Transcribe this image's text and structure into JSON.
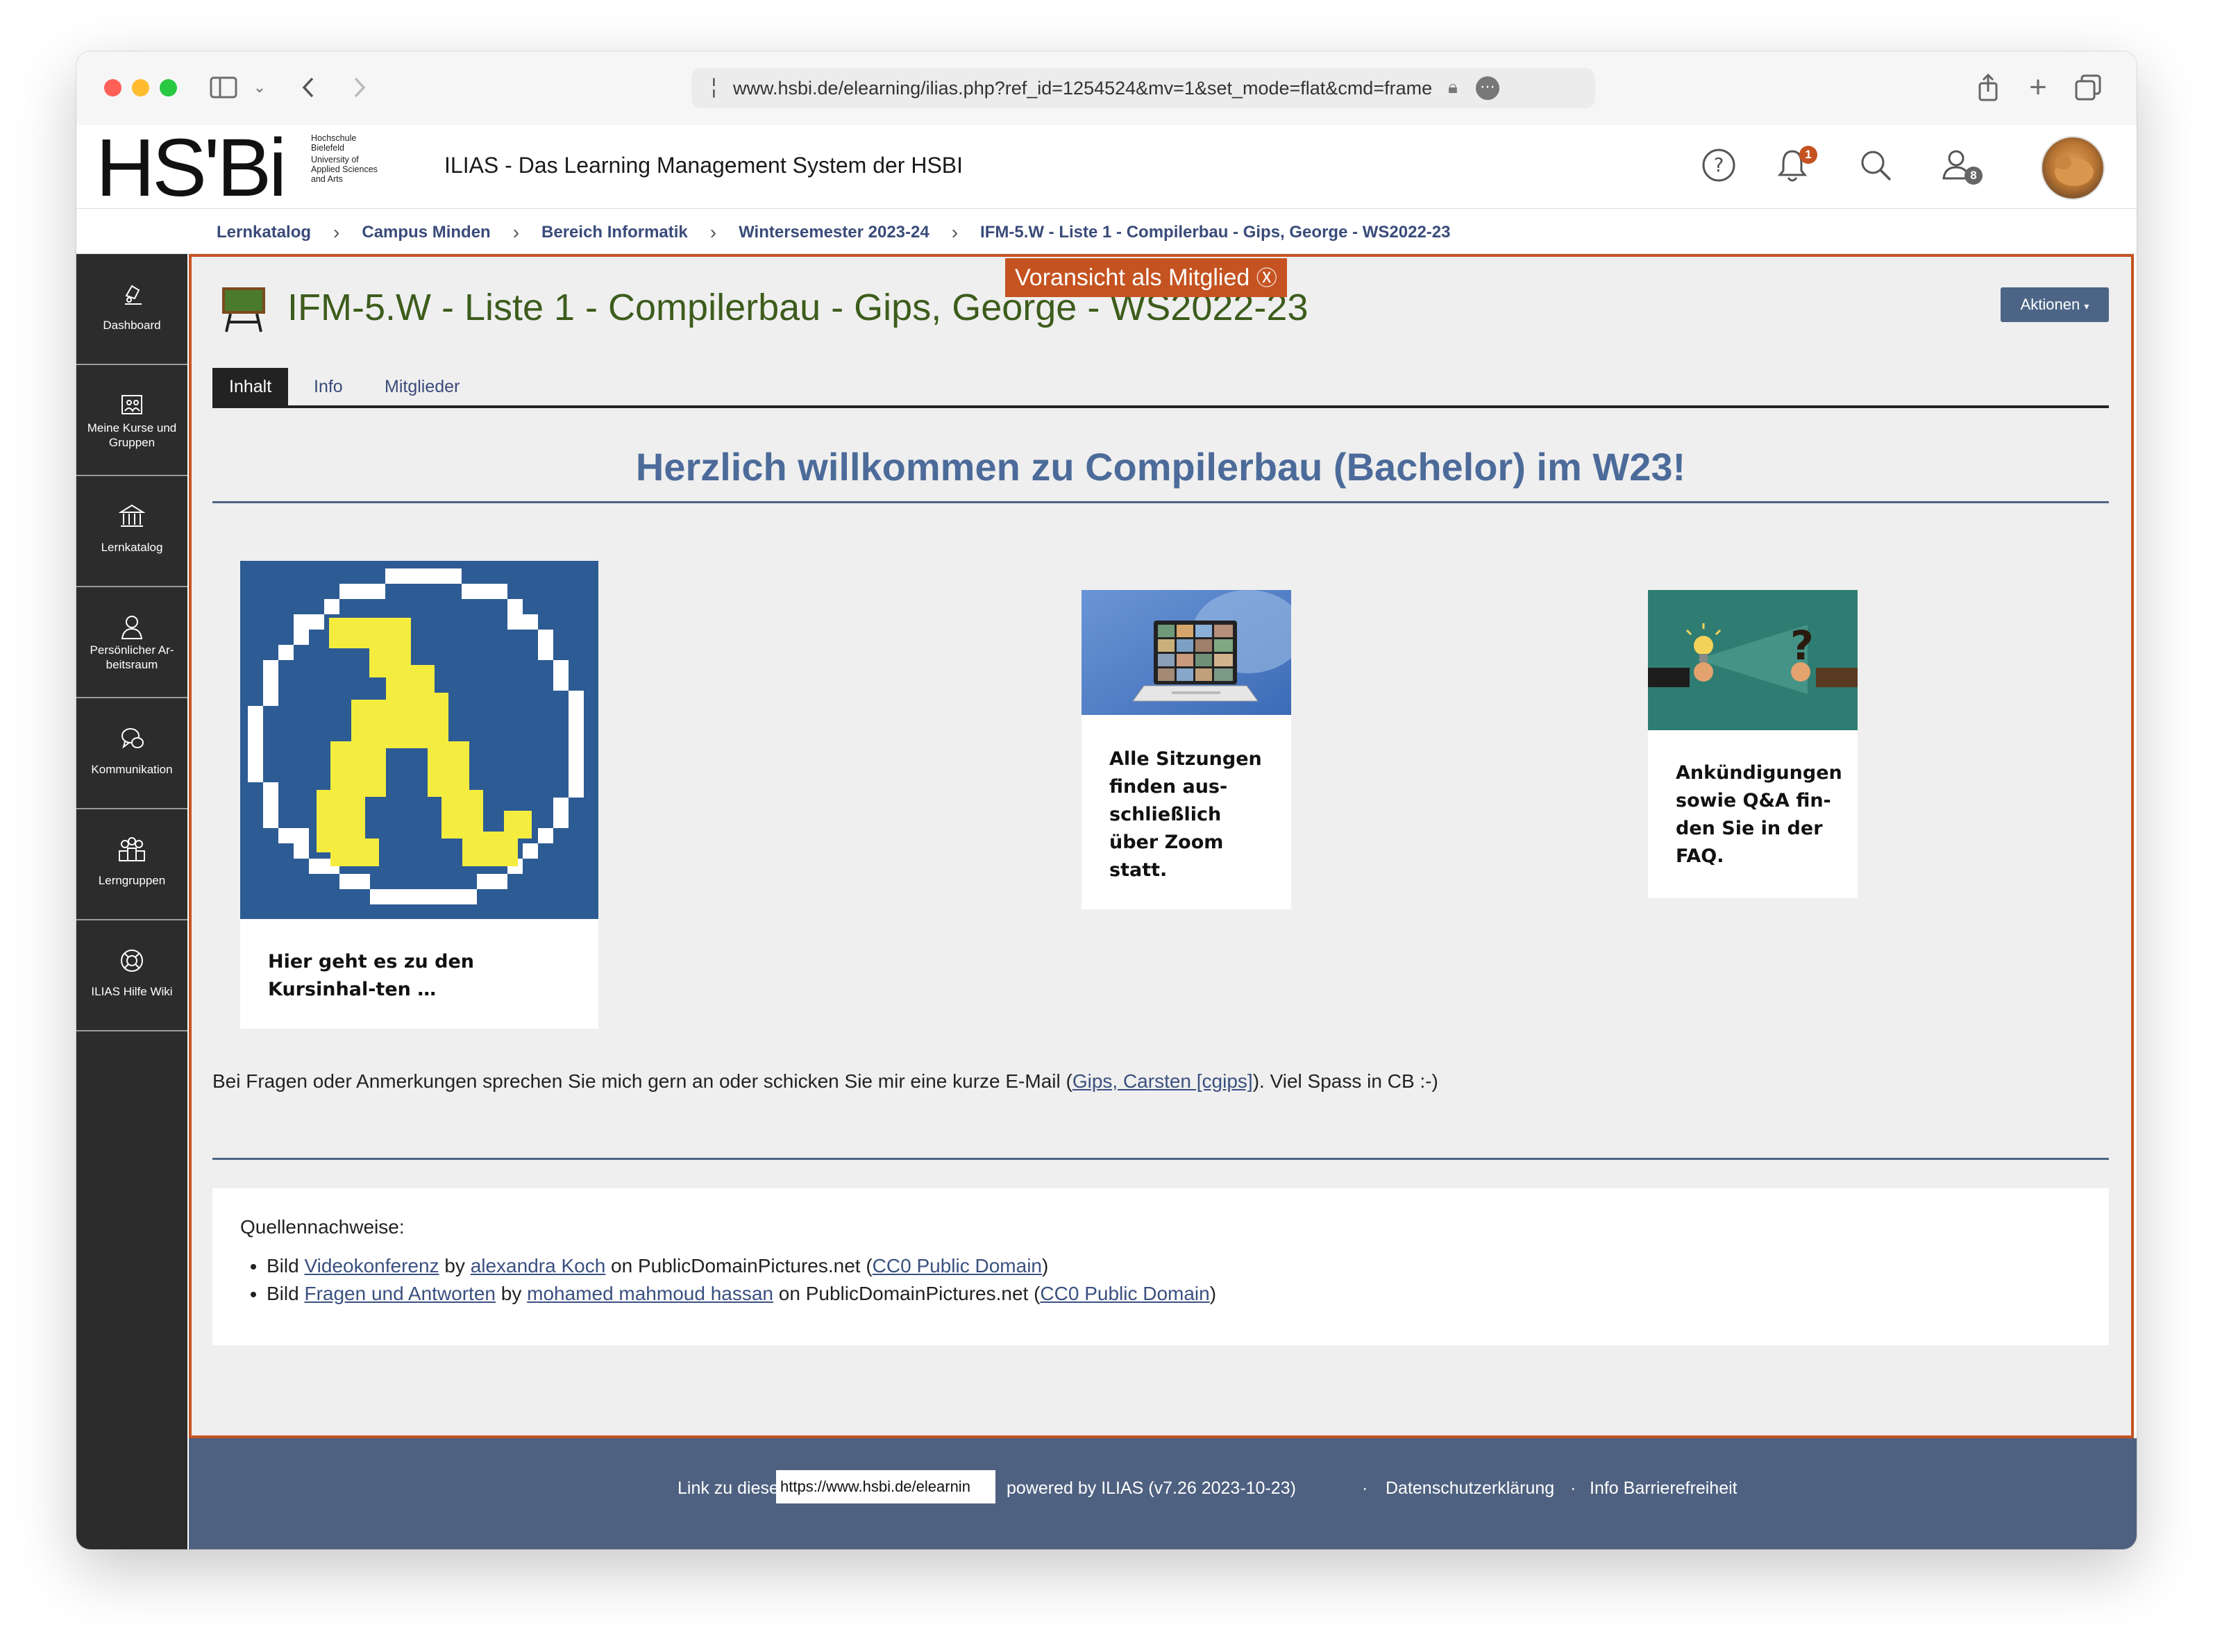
{
  "browser": {
    "url": "www.hsbi.de/elearning/ilias.php?ref_id=1254524&mv=1&set_mode=flat&cmd=frame",
    "icons": [
      "sidebar-icon",
      "chevron-down-icon",
      "back-icon",
      "forward-icon",
      "share-icon",
      "new-tab-icon",
      "tabs-icon"
    ]
  },
  "header": {
    "logo_text": "HS'Bi",
    "logo_sub": [
      "Hochschule",
      "Bielefeld",
      "University of",
      "Applied Sciences",
      "and Arts"
    ],
    "site_title": "ILIAS - Das Learning Management System der HSBI",
    "notification_count": "1",
    "contacts_count": "8"
  },
  "breadcrumb": [
    "Lernkatalog",
    "Campus Minden",
    "Bereich Informatik",
    "Wintersemester 2023-24",
    "IFM-5.W - Liste 1 - Compilerbau - Gips, George - WS2022-23"
  ],
  "sidebar": [
    {
      "label": "Dashboard",
      "icon": "dashboard-icon"
    },
    {
      "label": "Meine Kurse und Gruppen",
      "icon": "courses-icon"
    },
    {
      "label": "Lernkatalog",
      "icon": "catalog-icon"
    },
    {
      "label": "Persönlicher Ar-beitsraum",
      "icon": "personal-workspace-icon"
    },
    {
      "label": "Kommunikation",
      "icon": "communication-icon"
    },
    {
      "label": "Lerngruppen",
      "icon": "study-groups-icon"
    },
    {
      "label": "ILIAS Hilfe Wiki",
      "icon": "help-wiki-icon"
    }
  ],
  "main": {
    "title": "IFM-5.W - Liste 1 - Compilerbau - Gips, George - WS2022-23",
    "preview_label": "Voransicht als Mitglied",
    "actions_label": "Aktionen",
    "tabs": [
      "Inhalt",
      "Info",
      "Mitglieder"
    ],
    "welcome": "Herzlich willkommen zu Compilerbau (Bachelor) im W23!",
    "cards": [
      {
        "text": "Hier geht es zu den Kursinhal-ten …"
      },
      {
        "text": "Alle Sitzungen finden aus-schließlich über Zoom statt."
      },
      {
        "text": "Ankündigungen sowie Q&A fin-den Sie in der FAQ."
      }
    ],
    "contact_prefix": "Bei Fragen oder Anmerkungen sprechen Sie mich gern an oder schicken Sie mir eine kurze E-Mail (",
    "contact_link": "Gips, Carsten [cgips]",
    "contact_suffix": "). Viel Spass in CB :-)",
    "sources_heading": "Quellennachweise:",
    "sources": [
      {
        "pre": "Bild ",
        "work": "Videokonferenz",
        "by": " by ",
        "author": "alexandra Koch",
        "on": " on PublicDomainPictures.net (",
        "license": "CC0 Public Domain",
        "post": ")"
      },
      {
        "pre": "Bild ",
        "work": "Fragen und Antworten",
        "by": " by ",
        "author": "mohamed mahmoud hassan",
        "on": " on PublicDomainPictures.net (",
        "license": "CC0 Public Domain",
        "post": ")"
      }
    ]
  },
  "footer": {
    "permalink_label": "Link zu dieser Seite",
    "permalink_value": "https://www.hsbi.de/elearnin",
    "powered": "powered by ILIAS (v7.26 2023-10-23)",
    "privacy": "Datenschutzerklärung",
    "accessibility": "Info Barrierefreiheit",
    "separator": "·"
  },
  "colors": {
    "accent_orange": "#c55321",
    "title_green": "#3d5c1c",
    "welcome_blue": "#4c6b9a",
    "footer_blue": "#4f6180",
    "sidebar_dark": "#2c2c2c"
  }
}
